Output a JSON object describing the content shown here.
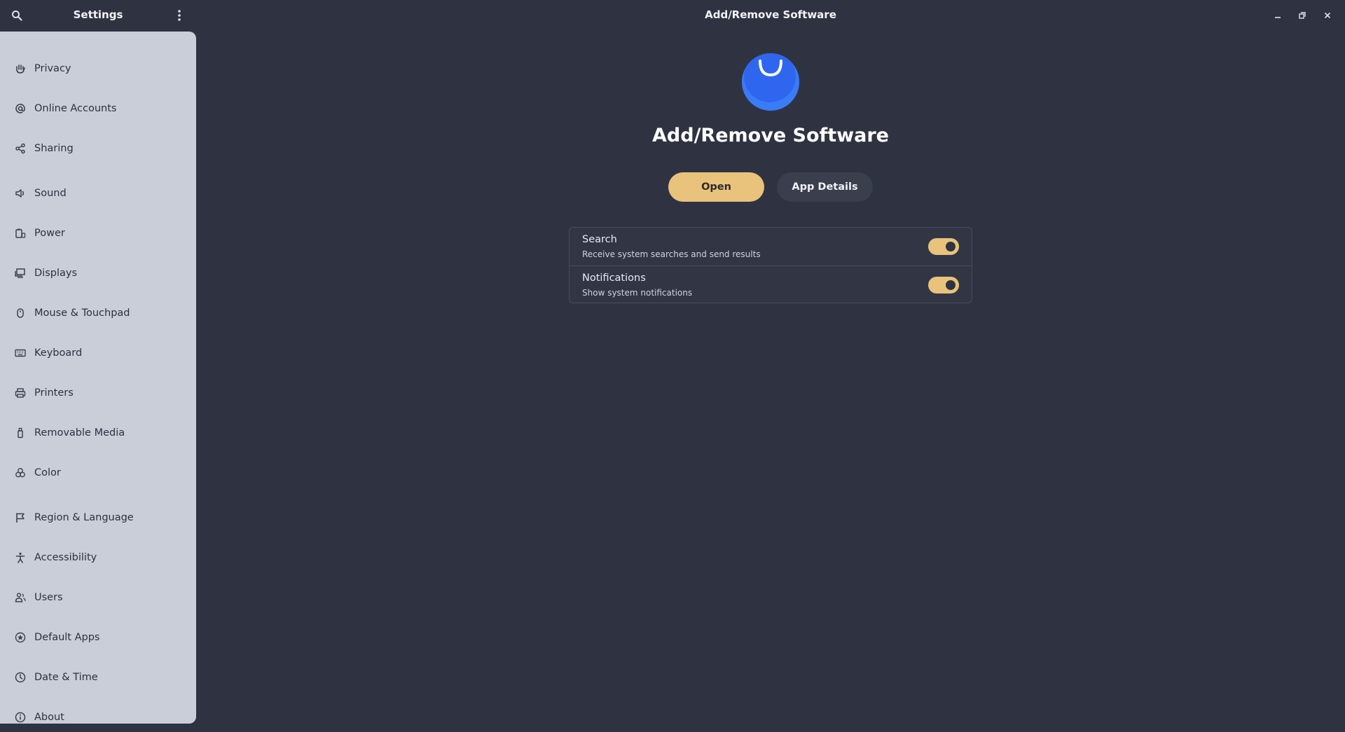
{
  "header": {
    "sidebar_title": "Settings",
    "window_title": "Add/Remove Software",
    "icons": [
      "search-icon",
      "kebab-menu-icon",
      "minimize-icon",
      "maximize-icon",
      "close-icon"
    ]
  },
  "sidebar": {
    "items": [
      {
        "label": "Privacy",
        "icon": "hand-icon"
      },
      {
        "label": "Online Accounts",
        "icon": "at-icon"
      },
      {
        "label": "Sharing",
        "icon": "share-icon"
      },
      {
        "label": "Sound",
        "icon": "speaker-icon"
      },
      {
        "label": "Power",
        "icon": "battery-icon"
      },
      {
        "label": "Displays",
        "icon": "display-icon"
      },
      {
        "label": "Mouse & Touchpad",
        "icon": "mouse-icon"
      },
      {
        "label": "Keyboard",
        "icon": "keyboard-icon"
      },
      {
        "label": "Printers",
        "icon": "printer-icon"
      },
      {
        "label": "Removable Media",
        "icon": "usb-icon"
      },
      {
        "label": "Color",
        "icon": "color-icon"
      },
      {
        "label": "Region & Language",
        "icon": "flag-icon"
      },
      {
        "label": "Accessibility",
        "icon": "accessibility-icon"
      },
      {
        "label": "Users",
        "icon": "users-icon"
      },
      {
        "label": "Default Apps",
        "icon": "star-icon"
      },
      {
        "label": "Date & Time",
        "icon": "clock-icon"
      },
      {
        "label": "About",
        "icon": "info-icon"
      }
    ]
  },
  "main": {
    "app_name": "Add/Remove Software",
    "open_label": "Open",
    "details_label": "App Details",
    "settings": [
      {
        "title": "Search",
        "subtitle": "Receive system searches and send results",
        "enabled": true
      },
      {
        "title": "Notifications",
        "subtitle": "Show system notifications",
        "enabled": true
      }
    ]
  },
  "colors": {
    "background": "#2f3341",
    "sidebar": "#c9ced9",
    "accent": "#e9c27b",
    "app_icon": "#3a7bf7"
  }
}
